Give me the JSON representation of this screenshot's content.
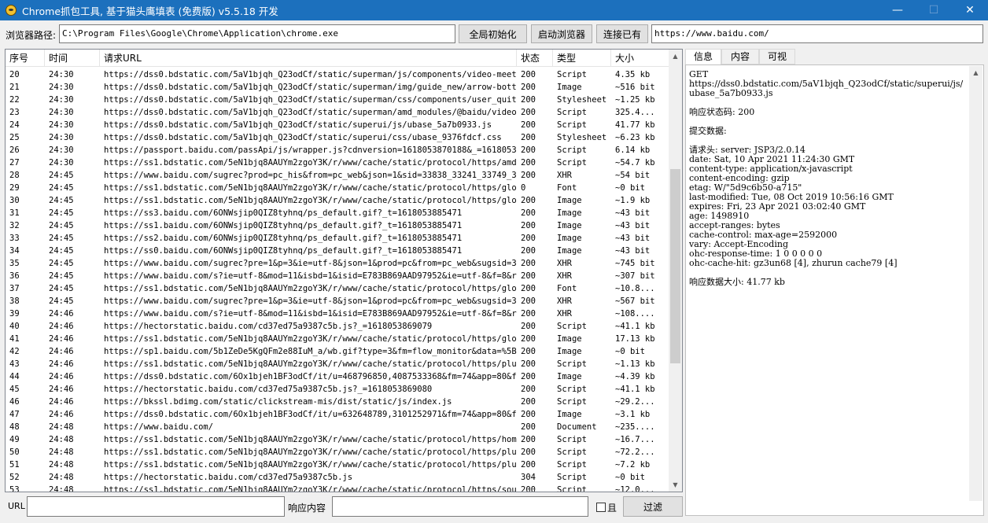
{
  "window": {
    "title": "Chrome抓包工具, 基于猫头鹰填表 (免费版) v5.5.18 开发",
    "minimize": "—",
    "maximize": "☐",
    "close": "✕"
  },
  "toolbar": {
    "path_label": "浏览器路径:",
    "path_value": "C:\\Program Files\\Google\\Chrome\\Application\\chrome.exe",
    "init_button": "全局初始化",
    "launch_button": "启动浏览器",
    "connect_button": "连接已有",
    "url_value": "https://www.baidu.com/"
  },
  "table": {
    "headers": [
      "序号",
      "时间",
      "请求URL",
      "状态",
      "类型",
      "大小"
    ],
    "rows": [
      [
        "20",
        "24:30",
        "https://dss0.bdstatic.com/5aV1bjqh_Q23odCf/static/superman/js/components/video-meet...",
        "200",
        "Script",
        "4.35 kb"
      ],
      [
        "21",
        "24:30",
        "https://dss0.bdstatic.com/5aV1bjqh_Q23odCf/static/superman/img/guide_new/arrow-bott...",
        "200",
        "Image",
        "~516 bit"
      ],
      [
        "22",
        "24:30",
        "https://dss0.bdstatic.com/5aV1bjqh_Q23odCf/static/superman/css/components/user_quit...",
        "200",
        "Stylesheet",
        "~1.25 kb"
      ],
      [
        "23",
        "24:30",
        "https://dss0.bdstatic.com/5aV1bjqh_Q23odCf/static/superman/amd_modules/@baidu/video...",
        "200",
        "Script",
        "325.4..."
      ],
      [
        "24",
        "24:30",
        "https://dss0.bdstatic.com/5aV1bjqh_Q23odCf/static/superui/js/ubase_5a7b0933.js",
        "200",
        "Script",
        "41.77 kb"
      ],
      [
        "25",
        "24:30",
        "https://dss0.bdstatic.com/5aV1bjqh_Q23odCf/static/superui/css/ubase_9376fdcf.css",
        "200",
        "Stylesheet",
        "~6.23 kb"
      ],
      [
        "26",
        "24:30",
        "https://passport.baidu.com/passApi/js/wrapper.js?cdnversion=1618053870188&_=1618053...",
        "200",
        "Script",
        "6.14 kb"
      ],
      [
        "27",
        "24:30",
        "https://ss1.bdstatic.com/5eN1bjq8AAUYm2zgoY3K/r/www/cache/static/protocol/https/amd...",
        "200",
        "Script",
        "~54.7 kb"
      ],
      [
        "28",
        "24:45",
        "https://www.baidu.com/sugrec?prod=pc_his&from=pc_web&json=1&sid=33838_33241_33749_3...",
        "200",
        "XHR",
        "~54 bit"
      ],
      [
        "29",
        "24:45",
        "https://ss1.bdstatic.com/5eN1bjq8AAUYm2zgoY3K/r/www/cache/static/protocol/https/glo...",
        "0",
        "Font",
        "~0 bit"
      ],
      [
        "30",
        "24:45",
        "https://ss1.bdstatic.com/5eN1bjq8AAUYm2zgoY3K/r/www/cache/static/protocol/https/glo...",
        "200",
        "Image",
        "~1.9 kb"
      ],
      [
        "31",
        "24:45",
        "https://ss3.baidu.com/6ONWsjip0QIZ8tyhnq/ps_default.gif?_t=1618053885471",
        "200",
        "Image",
        "~43 bit"
      ],
      [
        "32",
        "24:45",
        "https://ss1.baidu.com/6ONWsjip0QIZ8tyhnq/ps_default.gif?_t=1618053885471",
        "200",
        "Image",
        "~43 bit"
      ],
      [
        "33",
        "24:45",
        "https://ss2.baidu.com/6ONWsjip0QIZ8tyhnq/ps_default.gif?_t=1618053885471",
        "200",
        "Image",
        "~43 bit"
      ],
      [
        "34",
        "24:45",
        "https://ss0.baidu.com/6ONWsjip0QIZ8tyhnq/ps_default.gif?_t=1618053885471",
        "200",
        "Image",
        "~43 bit"
      ],
      [
        "35",
        "24:45",
        "https://www.baidu.com/sugrec?pre=1&p=3&ie=utf-8&json=1&prod=pc&from=pc_web&sugsid=3...",
        "200",
        "XHR",
        "~745 bit"
      ],
      [
        "36",
        "24:45",
        "https://www.baidu.com/s?ie=utf-8&mod=11&isbd=1&isid=E783B869AAD97952&ie=utf-8&f=8&r...",
        "200",
        "XHR",
        "~307 bit"
      ],
      [
        "37",
        "24:45",
        "https://ss1.bdstatic.com/5eN1bjq8AAUYm2zgoY3K/r/www/cache/static/protocol/https/glo...",
        "200",
        "Font",
        "~10.8..."
      ],
      [
        "38",
        "24:45",
        "https://www.baidu.com/sugrec?pre=1&p=3&ie=utf-8&json=1&prod=pc&from=pc_web&sugsid=3...",
        "200",
        "XHR",
        "~567 bit"
      ],
      [
        "39",
        "24:46",
        "https://www.baidu.com/s?ie=utf-8&mod=11&isbd=1&isid=E783B869AAD97952&ie=utf-8&f=8&r...",
        "200",
        "XHR",
        "~108...."
      ],
      [
        "40",
        "24:46",
        "https://hectorstatic.baidu.com/cd37ed75a9387c5b.js?_=1618053869079",
        "200",
        "Script",
        "~41.1 kb"
      ],
      [
        "41",
        "24:46",
        "https://ss1.bdstatic.com/5eN1bjq8AAUYm2zgoY3K/r/www/cache/static/protocol/https/glo...",
        "200",
        "Image",
        "17.13 kb"
      ],
      [
        "42",
        "24:46",
        "https://sp1.baidu.com/5b1ZeDe5KgQFm2e88IuM_a/wb.gif?type=3&fm=flow_monitor&data=%5B...",
        "200",
        "Image",
        "~0 bit"
      ],
      [
        "43",
        "24:46",
        "https://ss1.bdstatic.com/5eN1bjq8AAUYm2zgoY3K/r/www/cache/static/protocol/https/plu...",
        "200",
        "Script",
        "~1.13 kb"
      ],
      [
        "44",
        "24:46",
        "https://dss0.bdstatic.com/6Ox1bjeh1BF3odCf/it/u=468796850,4087533368&fm=74&app=80&f...",
        "200",
        "Image",
        "~4.39 kb"
      ],
      [
        "45",
        "24:46",
        "https://hectorstatic.baidu.com/cd37ed75a9387c5b.js?_=1618053869080",
        "200",
        "Script",
        "~41.1 kb"
      ],
      [
        "46",
        "24:46",
        "https://bkssl.bdimg.com/static/clickstream-mis/dist/static/js/index.js",
        "200",
        "Script",
        "~29.2..."
      ],
      [
        "47",
        "24:46",
        "https://dss0.bdstatic.com/6Ox1bjeh1BF3odCf/it/u=632648789,3101252971&fm=74&app=80&f...",
        "200",
        "Image",
        "~3.1 kb"
      ],
      [
        "48",
        "24:48",
        "https://www.baidu.com/",
        "200",
        "Document",
        "~235...."
      ],
      [
        "49",
        "24:48",
        "https://ss1.bdstatic.com/5eN1bjq8AAUYm2zgoY3K/r/www/cache/static/protocol/https/hom...",
        "200",
        "Script",
        "~16.7..."
      ],
      [
        "50",
        "24:48",
        "https://ss1.bdstatic.com/5eN1bjq8AAUYm2zgoY3K/r/www/cache/static/protocol/https/plu...",
        "200",
        "Script",
        "~72.2..."
      ],
      [
        "51",
        "24:48",
        "https://ss1.bdstatic.com/5eN1bjq8AAUYm2zgoY3K/r/www/cache/static/protocol/https/plu...",
        "200",
        "Script",
        "~7.2 kb"
      ],
      [
        "52",
        "24:48",
        "https://hectorstatic.baidu.com/cd37ed75a9387c5b.js",
        "304",
        "Script",
        "~0 bit"
      ],
      [
        "53",
        "24:48",
        "https://ss1.bdstatic.com/5eN1bjq8AAUYm2zgoY3K/r/www/cache/static/protocol/https/sou...",
        "200",
        "Script",
        "~12.0..."
      ]
    ]
  },
  "tabs": [
    "信息",
    "内容",
    "可视"
  ],
  "detail": {
    "text": "GET\nhttps://dss0.bdstatic.com/5aV1bjqh_Q23odCf/static/superui/js/ubase_5a7b0933.js\n\n响应状态码: 200\n\n提交数据:\n\n请求头: server: JSP3/2.0.14\ndate: Sat, 10 Apr 2021 11:24:30 GMT\ncontent-type: application/x-javascript\ncontent-encoding: gzip\netag: W/\"5d9c6b50-a715\"\nlast-modified: Tue, 08 Oct 2019 10:56:16 GMT\nexpires: Fri, 23 Apr 2021 03:02:40 GMT\nage: 1498910\naccept-ranges: bytes\ncache-control: max-age=2592000\nvary: Accept-Encoding\nohc-response-time: 1 0 0 0 0 0\nohc-cache-hit: gz3un68 [4], zhurun cache79 [4]\n\n响应数据大小: 41.77 kb"
  },
  "bottom": {
    "url_label": "URL",
    "resp_label": "响应内容",
    "and_label": "且",
    "filter_button": "过滤"
  },
  "icons": {
    "scroll_up": "▲",
    "scroll_down": "▼"
  }
}
